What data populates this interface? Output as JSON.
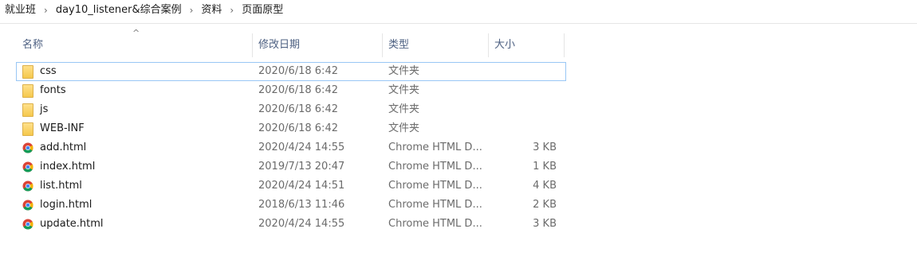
{
  "breadcrumb": [
    "就业班",
    "day10_listener&综合案例",
    "资料",
    "页面原型"
  ],
  "breadcrumb_separator": "›",
  "columns": {
    "name": "名称",
    "date": "修改日期",
    "type": "类型",
    "size": "大小"
  },
  "sort_indicator": "^",
  "files": [
    {
      "name": "css",
      "date": "2020/6/18 6:42",
      "type": "文件夹",
      "size": "",
      "icon": "folder-icon"
    },
    {
      "name": "fonts",
      "date": "2020/6/18 6:42",
      "type": "文件夹",
      "size": "",
      "icon": "folder-icon"
    },
    {
      "name": "js",
      "date": "2020/6/18 6:42",
      "type": "文件夹",
      "size": "",
      "icon": "folder-icon"
    },
    {
      "name": "WEB-INF",
      "date": "2020/6/18 6:42",
      "type": "文件夹",
      "size": "",
      "icon": "folder-icon"
    },
    {
      "name": "add.html",
      "date": "2020/4/24 14:55",
      "type": "Chrome HTML D...",
      "size": "3 KB",
      "icon": "chrome-icon"
    },
    {
      "name": "index.html",
      "date": "2019/7/13 20:47",
      "type": "Chrome HTML D...",
      "size": "1 KB",
      "icon": "chrome-icon"
    },
    {
      "name": "list.html",
      "date": "2020/4/24 14:51",
      "type": "Chrome HTML D...",
      "size": "4 KB",
      "icon": "chrome-icon"
    },
    {
      "name": "login.html",
      "date": "2018/6/13 11:46",
      "type": "Chrome HTML D...",
      "size": "2 KB",
      "icon": "chrome-icon"
    },
    {
      "name": "update.html",
      "date": "2020/4/24 14:55",
      "type": "Chrome HTML D...",
      "size": "3 KB",
      "icon": "chrome-icon"
    }
  ],
  "colors": {
    "header_text": "#4d6082",
    "selection_outline": "#99c7f5",
    "folder": "#f5c84c"
  }
}
